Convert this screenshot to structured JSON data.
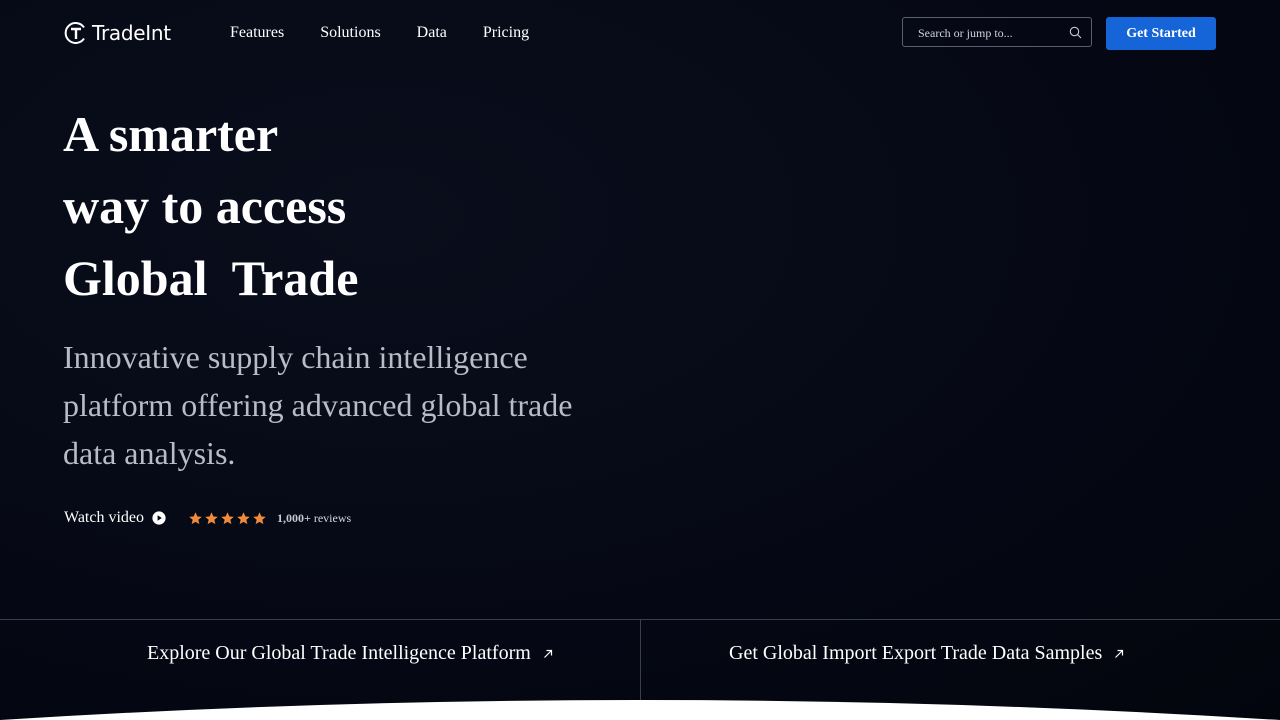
{
  "header": {
    "logo_text": "TradeInt",
    "nav": [
      "Features",
      "Solutions",
      "Data",
      "Pricing"
    ],
    "search_placeholder": "Search or jump to...",
    "cta_label": "Get Started"
  },
  "hero": {
    "line1": "A smarter",
    "line2": "way to access",
    "line3": "Global  Trade",
    "subtitle": "Innovative supply chain intelligence platform offering advanced global trade data analysis.",
    "watch_label": "Watch video",
    "rating": 5,
    "reviews_count": "1,000+",
    "reviews_label": "reviews"
  },
  "bottom": {
    "left_link": "Explore Our Global Trade Intelligence Platform",
    "right_link": "Get Global Import Export Trade Data Samples"
  },
  "colors": {
    "background": "#050814",
    "accent": "#1565d8",
    "star": "#f08a3c"
  },
  "icons": {
    "logo": "tradeint-logo-icon",
    "search": "search-icon",
    "play": "play-circle-icon",
    "star": "star-icon",
    "arrow": "arrow-up-right-icon"
  }
}
